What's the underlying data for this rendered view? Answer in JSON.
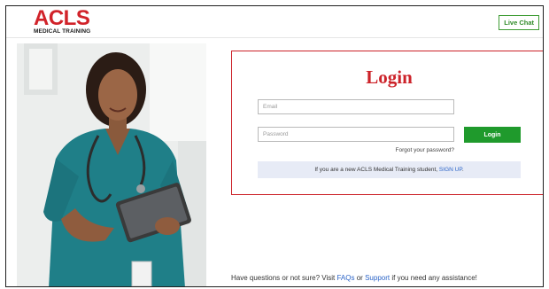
{
  "header": {
    "logo_main": "ACLS",
    "logo_sub": "MEDICAL TRAINING",
    "live_chat_label": "Live Chat"
  },
  "login": {
    "title": "Login",
    "email_placeholder": "Email",
    "password_placeholder": "Password",
    "button_label": "Login",
    "forgot_label": "Forgot your password?",
    "signup_prefix": "If you are a new ACLS Medical Training student,",
    "signup_link": "SIGN UP",
    "signup_suffix": "."
  },
  "footer": {
    "prefix": "Have questions or not sure? Visit",
    "faq_link": "FAQs",
    "or": "or",
    "support_link": "Support",
    "suffix": "if you need any assistance!"
  },
  "colors": {
    "brand_red": "#cc2229",
    "accent_green": "#1f9a2c",
    "link_blue": "#2a63c7",
    "signup_bg": "#e7ebf6"
  },
  "icons": {
    "hero": "nurse-with-tablet-photo"
  }
}
